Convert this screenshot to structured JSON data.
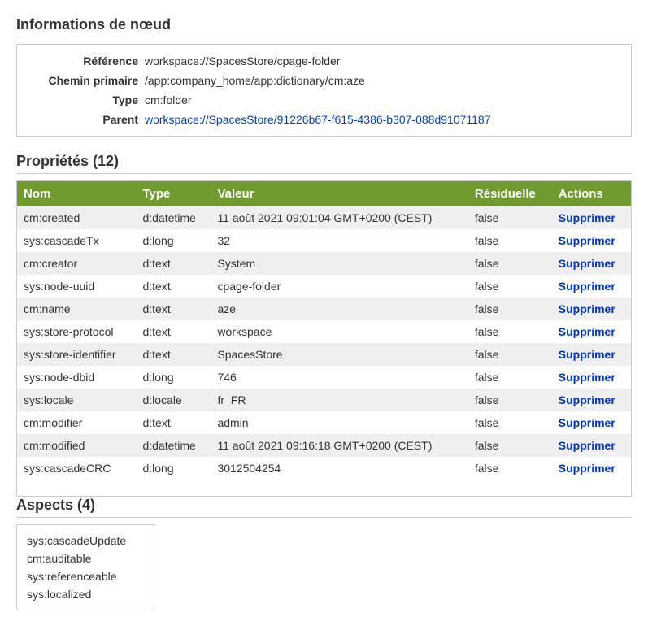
{
  "nodeInfo": {
    "title": "Informations de nœud",
    "fields": {
      "referenceLabel": "Référence",
      "referenceValue": "workspace://SpacesStore/cpage-folder",
      "primaryPathLabel": "Chemin primaire",
      "primaryPathValue": "/app:company_home/app:dictionary/cm:aze",
      "typeLabel": "Type",
      "typeValue": "cm:folder",
      "parentLabel": "Parent",
      "parentValue": "workspace://SpacesStore/91226b67-f615-4386-b307-088d91071187"
    }
  },
  "properties": {
    "title": "Propriétés (12)",
    "headers": {
      "name": "Nom",
      "type": "Type",
      "value": "Valeur",
      "residual": "Résiduelle",
      "actions": "Actions"
    },
    "actionLabel": "Supprimer",
    "rows": [
      {
        "name": "cm:created",
        "type": "d:datetime",
        "value": "11 août 2021 09:01:04 GMT+0200 (CEST)",
        "residual": "false"
      },
      {
        "name": "sys:cascadeTx",
        "type": "d:long",
        "value": "32",
        "residual": "false"
      },
      {
        "name": "cm:creator",
        "type": "d:text",
        "value": "System",
        "residual": "false"
      },
      {
        "name": "sys:node-uuid",
        "type": "d:text",
        "value": "cpage-folder",
        "residual": "false"
      },
      {
        "name": "cm:name",
        "type": "d:text",
        "value": "aze",
        "residual": "false"
      },
      {
        "name": "sys:store-protocol",
        "type": "d:text",
        "value": "workspace",
        "residual": "false"
      },
      {
        "name": "sys:store-identifier",
        "type": "d:text",
        "value": "SpacesStore",
        "residual": "false"
      },
      {
        "name": "sys:node-dbid",
        "type": "d:long",
        "value": "746",
        "residual": "false"
      },
      {
        "name": "sys:locale",
        "type": "d:locale",
        "value": "fr_FR",
        "residual": "false"
      },
      {
        "name": "cm:modifier",
        "type": "d:text",
        "value": "admin",
        "residual": "false"
      },
      {
        "name": "cm:modified",
        "type": "d:datetime",
        "value": "11 août 2021 09:16:18 GMT+0200 (CEST)",
        "residual": "false"
      },
      {
        "name": "sys:cascadeCRC",
        "type": "d:long",
        "value": "3012504254",
        "residual": "false"
      }
    ]
  },
  "aspects": {
    "title": "Aspects (4)",
    "items": [
      "sys:cascadeUpdate",
      "cm:auditable",
      "sys:referenceable",
      "sys:localized"
    ]
  }
}
